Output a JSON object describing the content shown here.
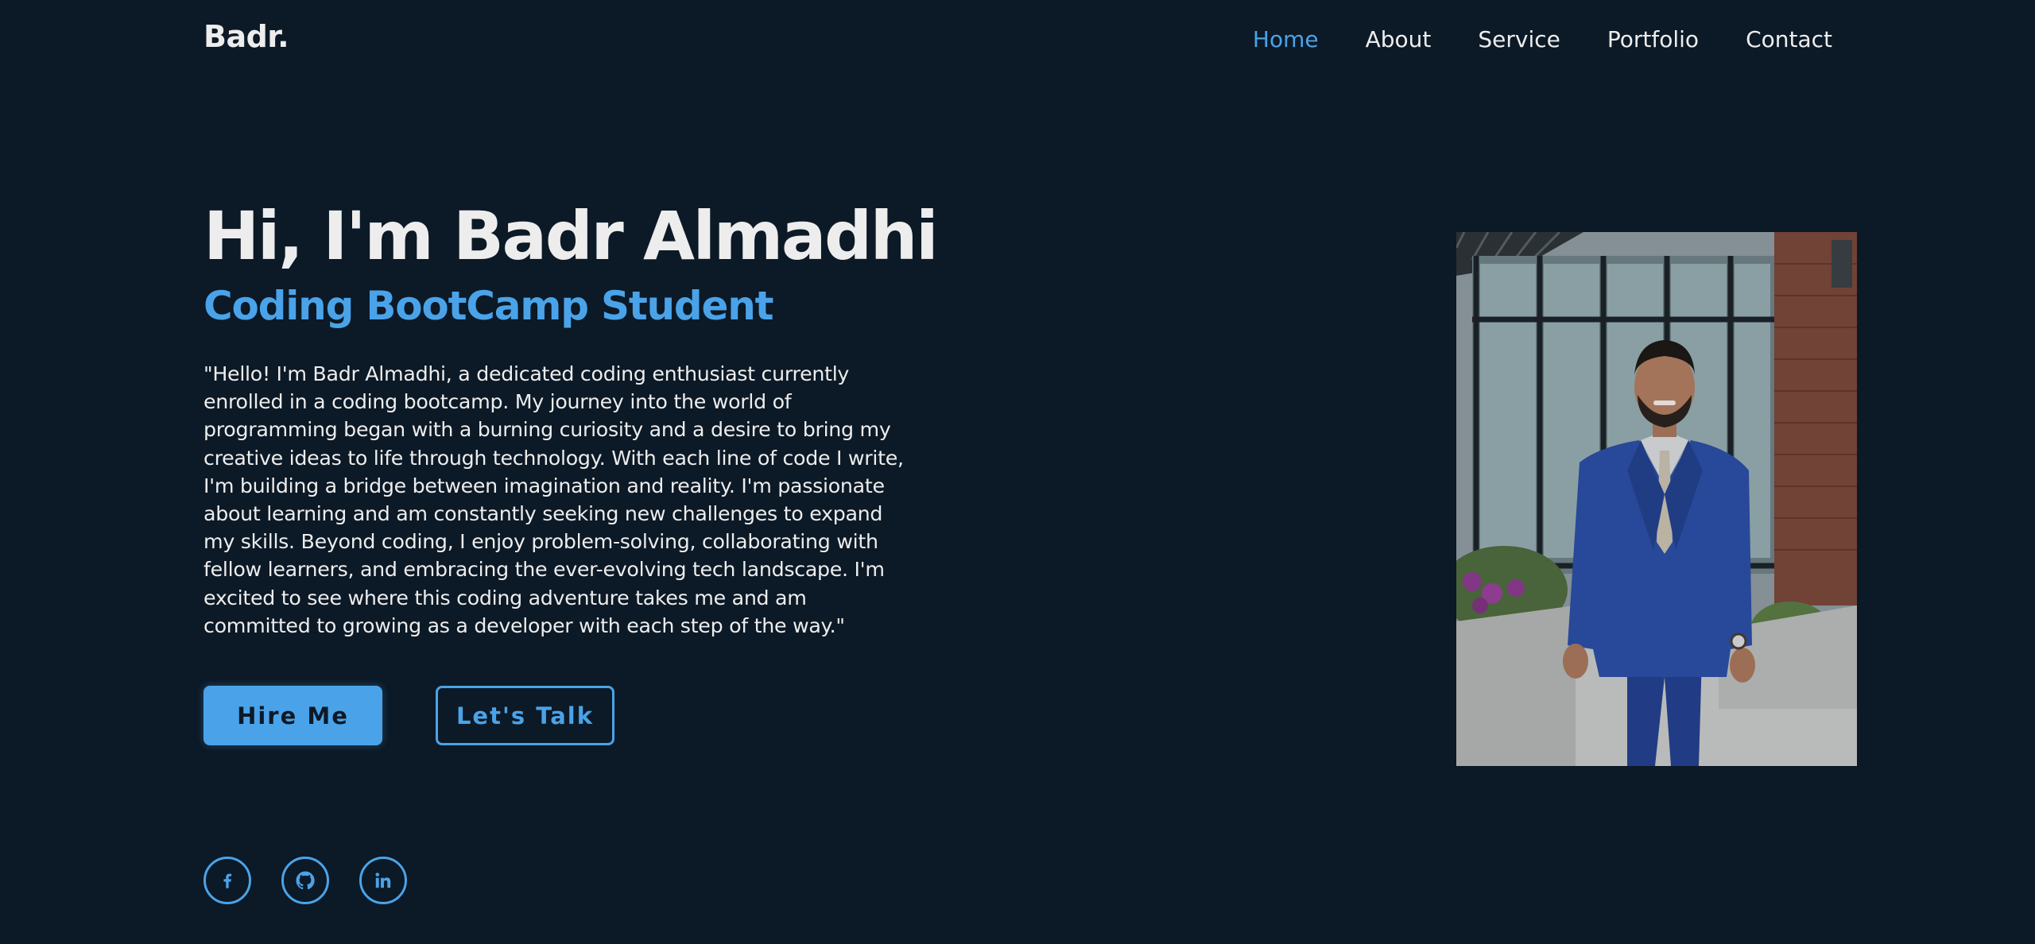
{
  "header": {
    "logo": "Badr.",
    "nav": [
      "Home",
      "About",
      "Service",
      "Portfolio",
      "Contact"
    ],
    "active_nav": "Home"
  },
  "hero": {
    "title": "Hi, I'm Badr Almadhi",
    "subtitle": "Coding BootCamp Student",
    "paragraph": "\"Hello! I'm Badr Almadhi, a dedicated coding enthusiast currently enrolled in a coding bootcamp. My journey into the world of programming began with a burning curiosity and a desire to bring my creative ideas to life through technology. With each line of code I write, I'm building a bridge between imagination and reality. I'm passionate about learning and am constantly seeking new challenges to expand my skills. Beyond coding, I enjoy problem-solving, collaborating with fellow learners, and embracing the ever-evolving tech landscape. I'm excited to see where this coding adventure takes me and am committed to growing as a developer with each step of the way.\"",
    "buttons": {
      "hire": "Hire Me",
      "talk": "Let's Talk"
    }
  },
  "social": {
    "icons": [
      "facebook-icon",
      "github-icon",
      "linkedin-icon"
    ]
  },
  "colors": {
    "background": "#0c1926",
    "accent": "#4aa3e8",
    "text": "#ededed"
  }
}
